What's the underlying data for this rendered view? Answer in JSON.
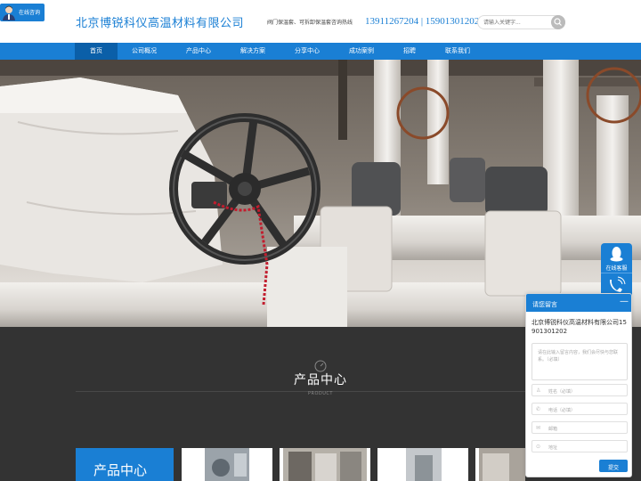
{
  "header": {
    "chat_badge": "在线咨询",
    "company_name": "北京博锐科仪高温材料有限公司",
    "hotline_label": "阀门保温套、可拆卸保温套咨询热线",
    "hotline": "13911267204 | 15901301202",
    "search_placeholder": "请输入关键字...",
    "icons": [
      "avatar-icon",
      "search-icon"
    ]
  },
  "nav": {
    "items": [
      "首页",
      "公司概况",
      "产品中心",
      "解决方案",
      "分享中心",
      "成功案例",
      "招聘",
      "联系我们"
    ],
    "active_index": 0
  },
  "banner": {
    "description_icons": [
      "handwheel",
      "insulation-jacket",
      "pipes"
    ]
  },
  "products": {
    "title": "产品中心",
    "subtitle": "PRODUCT",
    "card_label": "产品中心"
  },
  "float": {
    "service_label": "在线客服",
    "icons": [
      "qq-icon",
      "phone-icon"
    ]
  },
  "message": {
    "title": "请您留言",
    "minimize": "—",
    "company": "北京博锐科仪高温材料有限公司15901301202",
    "content_placeholder": "请在此输入留言内容，我们会尽快与您联系。（必填）",
    "name_placeholder": "姓名（必填）",
    "phone_placeholder": "电话（必填）",
    "email_placeholder": "邮箱",
    "address_placeholder": "地址",
    "submit": "提交"
  },
  "colors": {
    "brand": "#1a7fd4",
    "nav_active": "#0b5fa8",
    "dark_section": "#333333"
  }
}
